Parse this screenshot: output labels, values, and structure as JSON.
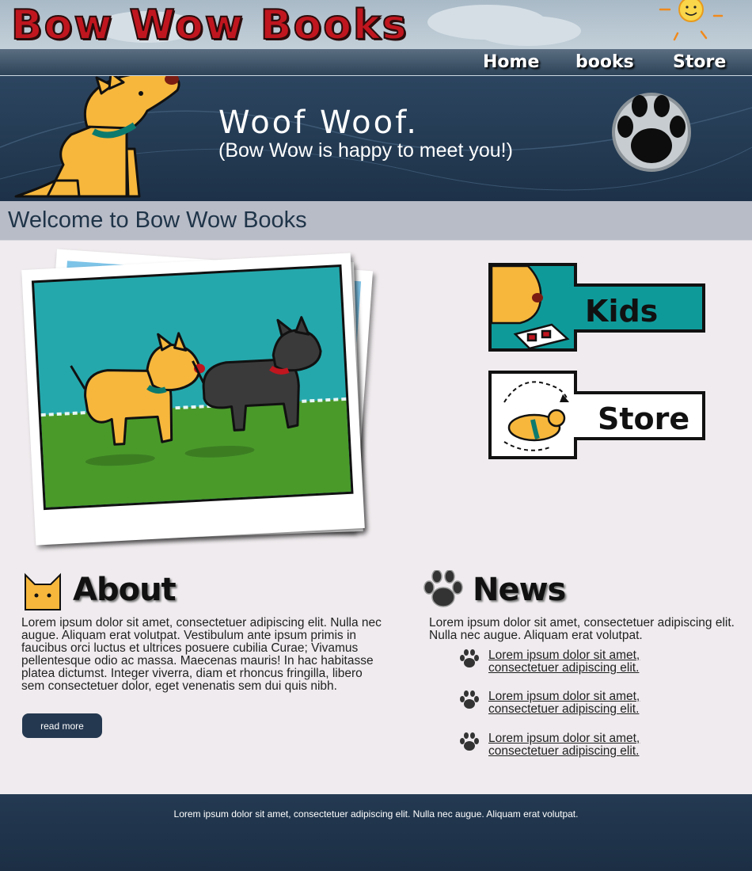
{
  "site": {
    "logo": "Bow Wow Books"
  },
  "nav": {
    "items": [
      "Home",
      "books",
      "Store"
    ]
  },
  "banner": {
    "title": "Woof Woof.",
    "subtitle": "(Bow Wow is happy to meet you!)"
  },
  "welcome": {
    "heading": "Welcome to Bow Wow Books"
  },
  "side_buttons": {
    "kids": "Kids",
    "store": "Store"
  },
  "about": {
    "title": "About",
    "text": "Lorem ipsum dolor sit amet, consectetuer adipiscing elit. Nulla nec augue. Aliquam erat volutpat. Vestibulum ante ipsum primis in faucibus orci luctus et ultrices posuere cubilia Curae; Vivamus pellentesque odio ac massa. Maecenas mauris! In hac habitasse platea dictumst. Integer viverra, diam et rhoncus fringilla, libero sem consectetuer dolor, eget venenatis sem dui quis nibh.",
    "button": "read more"
  },
  "news": {
    "title": "News",
    "intro": "Lorem ipsum dolor sit amet, consectetuer adipiscing elit. Nulla nec augue. Aliquam erat volutpat.",
    "items": [
      {
        "line1": "Lorem ipsum dolor sit amet,",
        "line2": "consectetuer adipiscing elit."
      },
      {
        "line1": "Lorem ipsum dolor sit amet,",
        "line2": "consectetuer adipiscing elit."
      },
      {
        "line1": "Lorem ipsum dolor sit amet,",
        "line2": "consectetuer adipiscing elit."
      }
    ]
  },
  "footer": {
    "text": "Lorem ipsum dolor sit amet, consectetuer adipiscing elit. Nulla nec augue. Aliquam erat volutpat."
  },
  "colors": {
    "accent": "#c0161f",
    "navy": "#243850",
    "teal": "#0f9a9a",
    "dog": "#f6b73c"
  }
}
